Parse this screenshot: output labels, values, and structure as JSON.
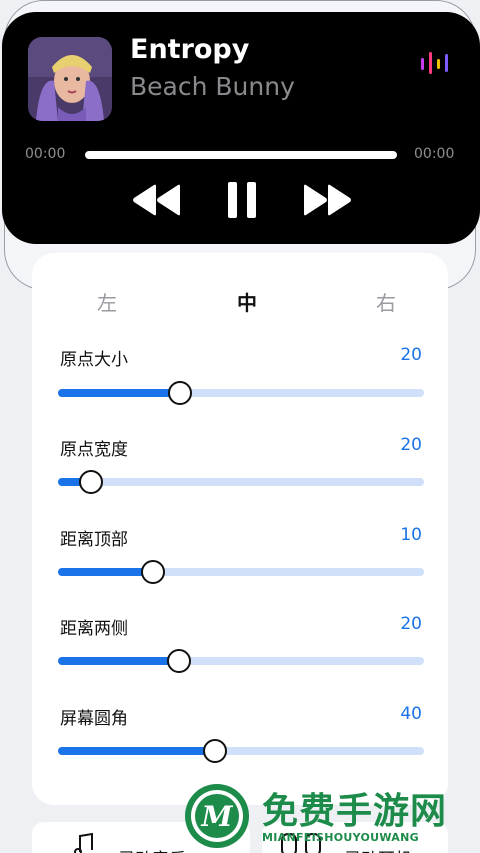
{
  "player": {
    "title": "Entropy",
    "artist": "Beach Bunny",
    "time_start": "00:00",
    "time_end": "00:00",
    "progress": 0,
    "visualizer_colors": [
      "#c83cf0",
      "#ff3b7f",
      "#f0c000",
      "#7a5cff"
    ],
    "controls": [
      "previous-icon",
      "pause-icon",
      "next-icon"
    ]
  },
  "tabs": {
    "left": "左",
    "center": "中",
    "right": "右",
    "selected": "中"
  },
  "sliders": [
    {
      "label": "原点大小",
      "value": "20",
      "fraction": 0.333
    },
    {
      "label": "原点宽度",
      "value": "20",
      "fraction": 0.09
    },
    {
      "label": "距离顶部",
      "value": "10",
      "fraction": 0.26
    },
    {
      "label": "距离两侧",
      "value": "20",
      "fraction": 0.33
    },
    {
      "label": "屏幕圆角",
      "value": "40",
      "fraction": 0.428
    }
  ],
  "bottom": {
    "item1": "灵动音乐",
    "item2": "灵动耳机"
  },
  "watermark": {
    "title": "免费手游网",
    "subtitle": "MIANFEISHOUYOUWANG",
    "badge_letter": "M"
  },
  "colors": {
    "accent": "#1a73e8",
    "track": "#cfe0f8",
    "watermark": "#1d8b4a"
  }
}
